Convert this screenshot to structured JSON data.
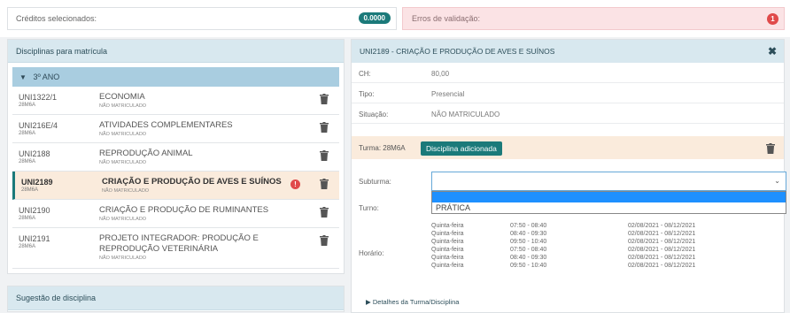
{
  "credits": {
    "label": "Créditos selecionados:",
    "value": "0.0000"
  },
  "errors": {
    "label": "Erros de validação:",
    "count": "1"
  },
  "enrollment": {
    "title": "Disciplinas para matrícula",
    "year": "3º ANO",
    "rows": [
      {
        "code": "UNI1322/1",
        "turma": "28M6A",
        "name": "ECONOMIA",
        "status": "NÃO MATRICULADO"
      },
      {
        "code": "UNI216E/4",
        "turma": "28M6A",
        "name": "ATIVIDADES COMPLEMENTARES",
        "status": "NÃO MATRICULADO"
      },
      {
        "code": "UNI2188",
        "turma": "28M6A",
        "name": "REPRODUÇÃO ANIMAL",
        "status": "NÃO MATRICULADO"
      },
      {
        "code": "UNI2189",
        "turma": "28M6A",
        "name": "CRIAÇÃO E PRODUÇÃO DE AVES E SUÍNOS",
        "status": "NÃO MATRICULADO",
        "alert": "!"
      },
      {
        "code": "UNI2190",
        "turma": "28M6A",
        "name": "CRIAÇÃO E PRODUÇÃO DE RUMINANTES",
        "status": "NÃO MATRICULADO"
      },
      {
        "code": "UNI2191",
        "turma": "28M6A",
        "name": "PROJETO INTEGRADOR: PRODUÇÃO E REPRODUÇÃO VETERINÁRIA",
        "status": "NÃO MATRICULADO"
      }
    ]
  },
  "suggestion": {
    "title": "Sugestão de disciplina"
  },
  "detail": {
    "title": "UNI2189 - CRIAÇÃO E PRODUÇÃO DE AVES E SUÍNOS",
    "ch_label": "CH:",
    "ch_value": "80,00",
    "tipo_label": "Tipo:",
    "tipo_value": "Presencial",
    "situacao_label": "Situação:",
    "situacao_value": "NÃO MATRICULADO",
    "turma_label": "Turma: 28M6A",
    "turma_badge": "Disciplina adicionada",
    "subturma_label": "Subturma:",
    "subturma_option": "PRÁTICA",
    "turno_label": "Turno:",
    "horario_label": "Horário:",
    "schedule_days": [
      "Quinta-feira",
      "Quinta-feira",
      "Quinta-feira",
      "Quinta-feira",
      "Quinta-feira",
      "Quinta-feira"
    ],
    "schedule_times": [
      "07:50 - 08:40",
      "08:40 - 09:30",
      "09:50 - 10:40",
      "07:50 - 08:40",
      "08:40 - 09:30",
      "09:50 - 10:40"
    ],
    "schedule_dates": [
      "02/08/2021 - 08/12/2021",
      "02/08/2021 - 08/12/2021",
      "02/08/2021 - 08/12/2021",
      "02/08/2021 - 08/12/2021",
      "02/08/2021 - 08/12/2021",
      "02/08/2021 - 08/12/2021"
    ],
    "details_link": "Detalhes da Turma/Disciplina"
  },
  "colors": {
    "accent": "#1b7a7a",
    "danger": "#e04a4a",
    "selected_row": "#faebdc",
    "panel_head": "#d8e8ef"
  }
}
